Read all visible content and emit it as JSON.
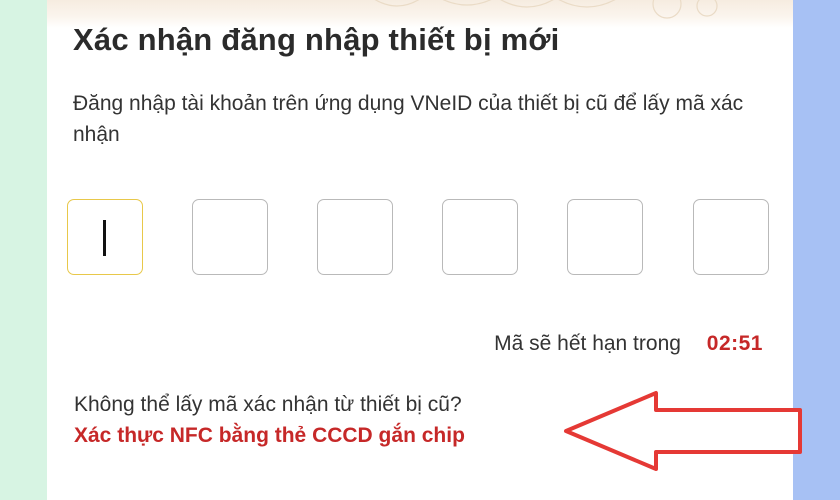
{
  "screen": {
    "title": "Xác nhận đăng nhập thiết bị mới",
    "subtitle": "Đăng nhập tài khoản trên ứng dụng VNeID của thiết bị cũ để lấy mã xác nhận",
    "otp": {
      "length": 6,
      "values": [
        "",
        "",
        "",
        "",
        "",
        ""
      ],
      "active_index": 0
    },
    "expiry": {
      "label": "Mã sẽ hết hạn trong",
      "timer": "02:51"
    },
    "help": {
      "question": "Không thể lấy mã xác nhận từ thiết bị cũ?",
      "link": "Xác thực NFC bằng thẻ CCCD gắn chip"
    }
  },
  "colors": {
    "accent_red": "#c62828",
    "active_border": "#e8c84a",
    "box_border": "#b9b9b9",
    "left_panel": "#d7f4e3",
    "right_panel": "#a7c1f4",
    "arrow": "#e53935"
  }
}
